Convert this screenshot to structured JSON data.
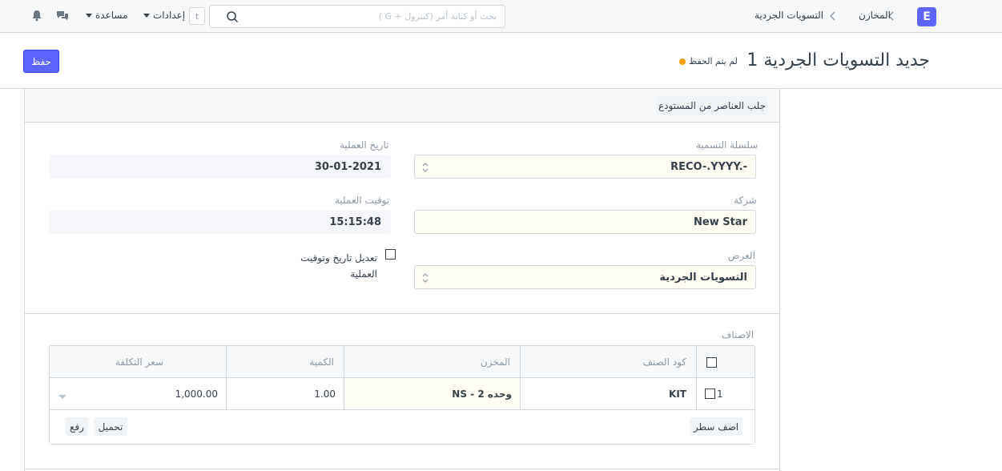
{
  "navbar": {
    "logo_letter": "E",
    "breadcrumbs": [
      "المخازن",
      "التسويات الجردية"
    ],
    "search_placeholder": "بحث أو كتابة أمر (كنترول + G )",
    "shortcut_key": "t",
    "settings_label": "إعدادات",
    "help_label": "مساعدة",
    "icons": [
      "chat-icon",
      "bell-icon"
    ]
  },
  "page": {
    "title": "جديد التسويات الجردية 1",
    "status": "لم يتم الحفظ",
    "status_color": "#ffa00a",
    "save_label": "حفظ",
    "accent": "#5e64ff"
  },
  "toolbar": {
    "get_items_label": "جلب العناصر من المستودع"
  },
  "form": {
    "naming_series_label": "سلسلة التسمية",
    "naming_series_value": "RECO-.YYYY.-",
    "posting_date_label": "تاريخ العملية",
    "posting_date_value": "30-01-2021",
    "company_label": "شركة",
    "company_value": "New Star",
    "posting_time_label": "توقيت العملية",
    "posting_time_value": "15:15:48",
    "purpose_label": "الغرض",
    "purpose_value": "التسويات الجردية",
    "edit_posting_label": "تعديل تاريخ وتوقيت العملية",
    "edit_posting_checked": false
  },
  "items": {
    "section_label": "الاصناف",
    "columns": [
      "كود الصنف",
      "المخزن",
      "الكمية",
      "سعر التكلفة"
    ],
    "rows": [
      {
        "idx": "1",
        "item_code": "KIT",
        "warehouse": "وحده 2 - NS",
        "qty": "1.00",
        "valuation_rate": "1,000.00"
      }
    ],
    "add_row_label": "اضف سطر",
    "download_label": "تحميل",
    "upload_label": "رفع"
  }
}
